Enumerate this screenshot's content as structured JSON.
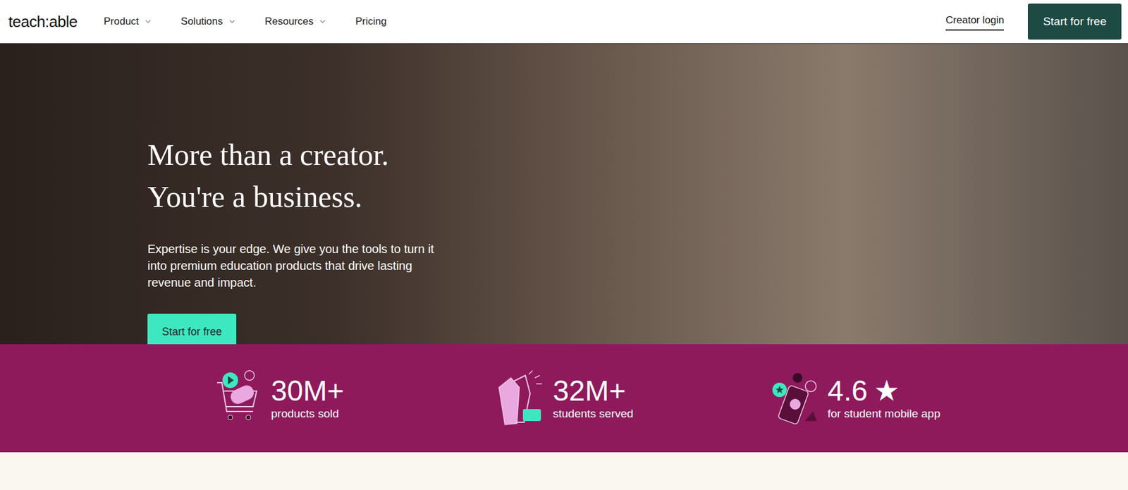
{
  "header": {
    "logo": "teach:able",
    "nav": [
      {
        "label": "Product",
        "dropdown": true
      },
      {
        "label": "Solutions",
        "dropdown": true
      },
      {
        "label": "Resources",
        "dropdown": true
      },
      {
        "label": "Pricing",
        "dropdown": false
      }
    ],
    "login": "Creator login",
    "cta": "Start for free"
  },
  "hero": {
    "title_lines": [
      "More than a creator.",
      "You're a business."
    ],
    "text": "Expertise is your edge. We give you the tools to turn it into premium education products that drive lasting revenue and impact.",
    "cta": "Start for free"
  },
  "stats": [
    {
      "kind": "cart",
      "value": "30M+",
      "suffix": "",
      "label": "products sold"
    },
    {
      "kind": "hands",
      "value": "32M+",
      "suffix": "",
      "label": "students served"
    },
    {
      "kind": "phone",
      "value": "4.6",
      "suffix": "★",
      "label": "for student mobile app"
    }
  ]
}
